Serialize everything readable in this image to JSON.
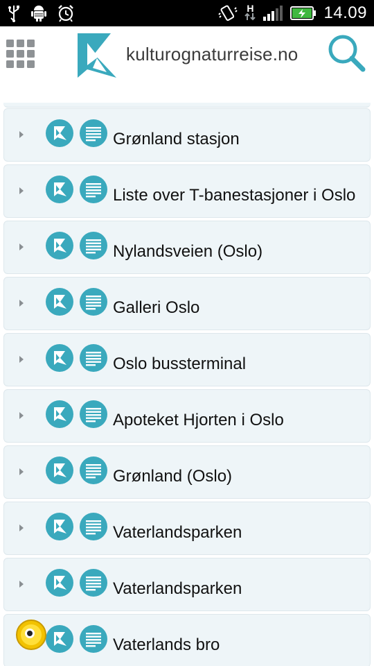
{
  "status_bar": {
    "time": "14.09",
    "network_label": "H",
    "icons": [
      "usb-icon",
      "android-debug-icon",
      "alarm-icon",
      "vibrate-icon",
      "network-h-icon",
      "signal-icon",
      "battery-charging-icon"
    ]
  },
  "header": {
    "menu_icon": "grid-menu-icon",
    "logo_text": "kulturognaturreise.no",
    "search_icon": "search-icon",
    "accent": "#3aa9bd"
  },
  "list": {
    "items": [
      {
        "title": "Grønland stasjon"
      },
      {
        "title": "Liste over T-banestasjoner i Oslo"
      },
      {
        "title": "Nylandsveien (Oslo)"
      },
      {
        "title": "Galleri Oslo"
      },
      {
        "title": "Oslo bussterminal"
      },
      {
        "title": "Apoteket Hjorten i Oslo"
      },
      {
        "title": "Grønland (Oslo)"
      },
      {
        "title": "Vaterlandsparken"
      },
      {
        "title": "Vaterlandsparken"
      },
      {
        "title": "Vaterlands bro"
      }
    ]
  },
  "colors": {
    "row_bg": "#eef5f8",
    "icon_bg": "#3aa9bd",
    "status_bg": "#000000"
  }
}
